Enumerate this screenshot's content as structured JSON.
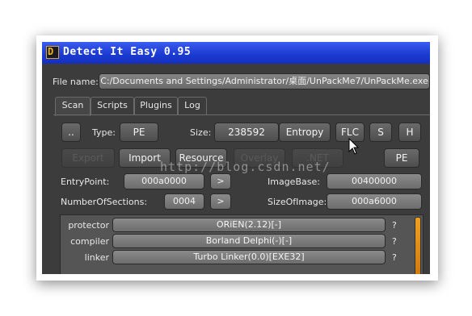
{
  "window": {
    "title": "Detect It Easy 0.95",
    "icon": "die-logo-icon"
  },
  "file": {
    "label": "File name:",
    "path": "C:/Documents and Settings/Administrator/桌面/UnPackMe7/UnPackMe.exe"
  },
  "tabs": [
    {
      "label": "Scan",
      "active": true
    },
    {
      "label": "Scripts",
      "active": false
    },
    {
      "label": "Plugins",
      "active": false
    },
    {
      "label": "Log",
      "active": false
    }
  ],
  "scan": {
    "browse_label": "..",
    "type_label": "Type:",
    "type_value": "PE",
    "size_label": "Size:",
    "size_value": "238592",
    "entropy_label": "Entropy",
    "flc_label": "FLC",
    "s_label": "S",
    "h_label": "H",
    "export_label": "Export",
    "import_label": "Import",
    "resource_label": "Resource",
    "overlay_label": "Overlay",
    "net_label": ".NET",
    "pe_label": "PE",
    "entrypoint_label": "EntryPoint:",
    "entrypoint_value": "000a0000",
    "imagebase_label": "ImageBase:",
    "imagebase_value": "00400000",
    "sections_label": "NumberOfSections:",
    "sections_value": "0004",
    "sizeofimage_label": "SizeOfImage:",
    "sizeofimage_value": "000a6000",
    "go_label": ">"
  },
  "results": [
    {
      "type": "protector",
      "value": "ORiEN(2.12)[-]",
      "info": "?"
    },
    {
      "type": "compiler",
      "value": "Borland Delphi(-)[-]",
      "info": "?"
    },
    {
      "type": "linker",
      "value": "Turbo Linker(0.0)[EXE32]",
      "info": "?"
    }
  ],
  "watermark": "http://blog.csdn.net/",
  "colors": {
    "titlebar": "#1a3ad0",
    "window_bg": "#3c3c3c",
    "scrollbar": "#f0a020"
  }
}
